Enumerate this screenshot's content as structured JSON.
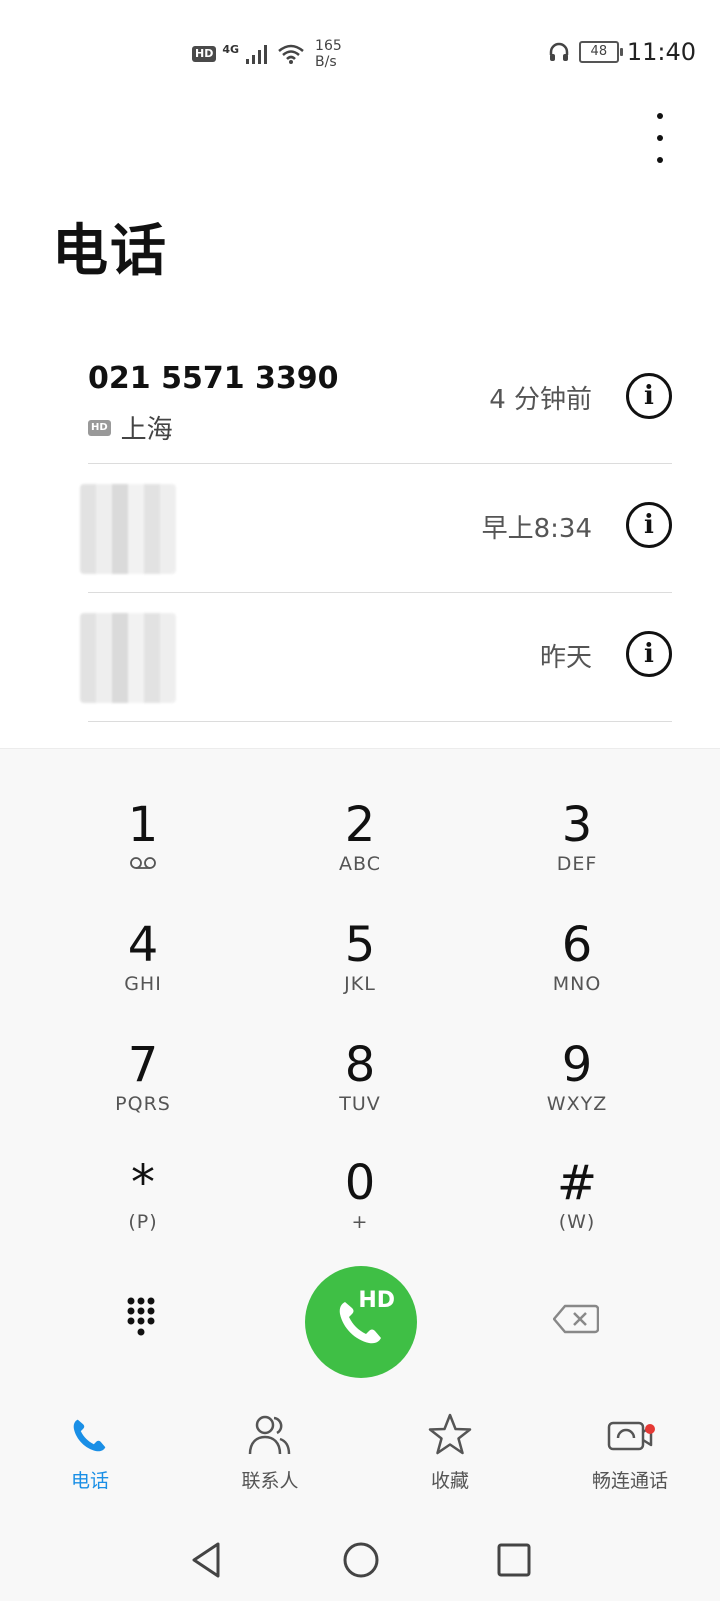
{
  "status_bar": {
    "hd_label": "HD",
    "network_type": "4G",
    "speed_value": "165",
    "speed_unit": "B/s",
    "battery_level": "48",
    "time": "11:40"
  },
  "page_title": "电话",
  "recent_calls": [
    {
      "number": "021 5571 3390",
      "hd_label": "HD",
      "location": "上海",
      "time": "4 分钟前"
    },
    {
      "number": "",
      "location": "",
      "time": "早上8:34"
    },
    {
      "number": "",
      "location": "",
      "time": "昨天"
    }
  ],
  "keypad": [
    {
      "digit": "1",
      "letters": ""
    },
    {
      "digit": "2",
      "letters": "ABC"
    },
    {
      "digit": "3",
      "letters": "DEF"
    },
    {
      "digit": "4",
      "letters": "GHI"
    },
    {
      "digit": "5",
      "letters": "JKL"
    },
    {
      "digit": "6",
      "letters": "MNO"
    },
    {
      "digit": "7",
      "letters": "PQRS"
    },
    {
      "digit": "8",
      "letters": "TUV"
    },
    {
      "digit": "9",
      "letters": "WXYZ"
    },
    {
      "digit": "*",
      "letters": "(P)"
    },
    {
      "digit": "0",
      "letters": "+"
    },
    {
      "digit": "#",
      "letters": "(W)"
    }
  ],
  "call_button": {
    "hd_label": "HD",
    "icon": "phone-icon"
  },
  "bottom_nav": [
    {
      "label": "电话",
      "icon": "phone-icon",
      "active": true
    },
    {
      "label": "联系人",
      "icon": "contacts-icon",
      "active": false
    },
    {
      "label": "收藏",
      "icon": "star-icon",
      "active": false
    },
    {
      "label": "畅连通话",
      "icon": "video-call-icon",
      "active": false
    }
  ],
  "colors": {
    "accent": "#1a8fe6",
    "call_green": "#3fbf45",
    "notification_red": "#e53935"
  }
}
